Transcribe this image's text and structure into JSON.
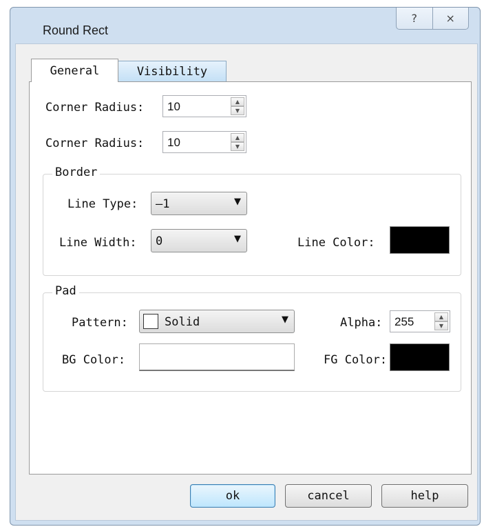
{
  "window": {
    "title": "Round Rect",
    "help_icon": "question-mark-icon",
    "close_icon": "close-x-icon"
  },
  "tabs": [
    {
      "label": "General",
      "active": true
    },
    {
      "label": "Visibility",
      "active": false
    }
  ],
  "general": {
    "corner_radius_1": {
      "label": "Corner Radius:",
      "value": "10"
    },
    "corner_radius_2": {
      "label": "Corner Radius:",
      "value": "10"
    },
    "border": {
      "title": "Border",
      "line_type": {
        "label": "Line Type:",
        "value": "—1"
      },
      "line_width": {
        "label": "Line Width:",
        "value": "0"
      },
      "line_color": {
        "label": "Line Color:",
        "color": "#000000"
      }
    },
    "pad": {
      "title": "Pad",
      "pattern": {
        "label": "Pattern:",
        "value": "Solid"
      },
      "alpha": {
        "label": "Alpha:",
        "value": "255"
      },
      "bg_color": {
        "label": "BG Color:",
        "color": "#ffffff"
      },
      "fg_color": {
        "label": "FG Color:",
        "color": "#000000"
      }
    }
  },
  "buttons": {
    "ok": "ok",
    "cancel": "cancel",
    "help": "help"
  }
}
